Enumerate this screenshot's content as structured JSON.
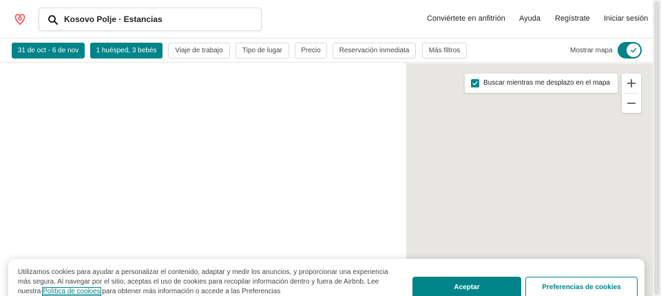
{
  "brand": {
    "logo_icon": "airbnb-logo",
    "color": "#FF5A5F",
    "accent": "#008489"
  },
  "search": {
    "value": "Kosovo Polje · Estancias",
    "icon": "search-icon"
  },
  "nav": {
    "host": "Conviértete en anfitrión",
    "help": "Ayuda",
    "signup": "Regístrate",
    "login": "Iniciar sesión"
  },
  "filters": {
    "dates": "31 de oct - 6 de nov",
    "guests": "1 huésped, 3 bebés",
    "work_trip": "Viaje de trabajo",
    "place_type": "Tipo de lugar",
    "price": "Precio",
    "instant_book": "Reservación inmediata",
    "more_filters": "Más filtros",
    "show_map_label": "Mostrar mapa",
    "show_map_enabled": true
  },
  "map": {
    "search_as_move_label": "Buscar mientras me desplazo en el mapa",
    "search_as_move_checked": true,
    "zoom_in_icon": "plus-icon",
    "zoom_out_icon": "minus-icon"
  },
  "cookie_banner": {
    "text_before_link": "Utilizamos cookies para ayudar a personalizar el contenido, adaptar y medir los anuncios, y proporcionar una experiencia más segura. Al navegar por el sitio, aceptas el uso de cookies para recopilar información dentro y fuera de Airbnb. Lee nuestra ",
    "link_text": "Política de cookies",
    "text_after_link": " para obtener más información o accede a las Preferencias",
    "accept_label": "Aceptar",
    "preferences_label": "Preferencias de cookies"
  }
}
